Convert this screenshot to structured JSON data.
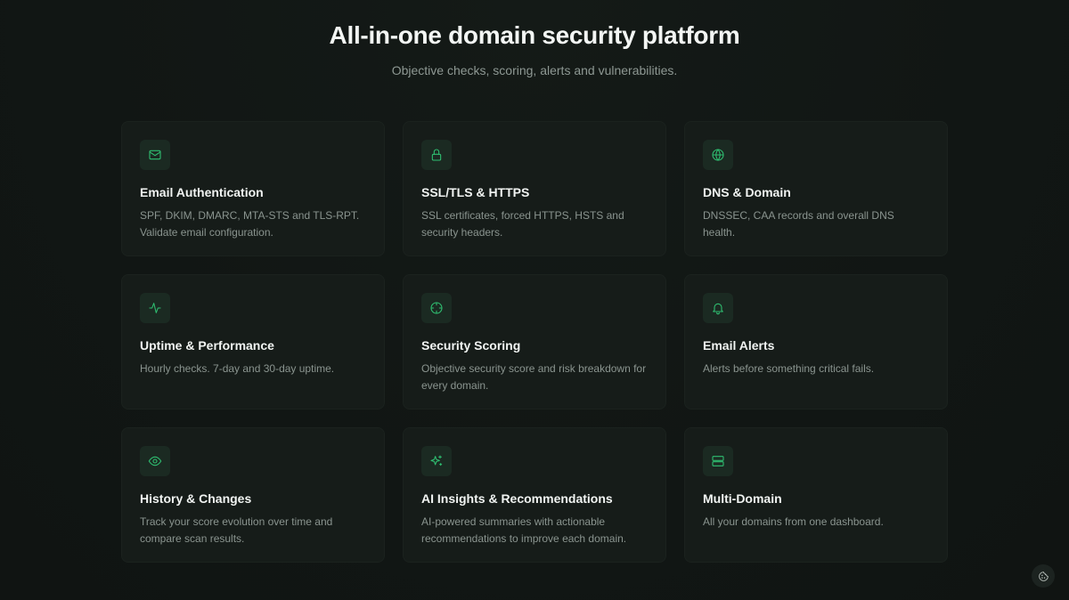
{
  "hero": {
    "title": "All-in-one domain security platform",
    "subtitle": "Objective checks, scoring, alerts and vulnerabilities."
  },
  "accent_color": "#2fbf71",
  "features": [
    {
      "icon": "mail-icon",
      "title": "Email Authentication",
      "description": "SPF, DKIM, DMARC, MTA-STS and TLS-RPT. Validate email configuration."
    },
    {
      "icon": "lock-icon",
      "title": "SSL/TLS & HTTPS",
      "description": "SSL certificates, forced HTTPS, HSTS and security headers."
    },
    {
      "icon": "globe-icon",
      "title": "DNS & Domain",
      "description": "DNSSEC, CAA records and overall DNS health."
    },
    {
      "icon": "activity-icon",
      "title": "Uptime & Performance",
      "description": "Hourly checks. 7-day and 30-day uptime."
    },
    {
      "icon": "crosshair-icon",
      "title": "Security Scoring",
      "description": "Objective security score and risk breakdown for every domain."
    },
    {
      "icon": "bell-icon",
      "title": "Email Alerts",
      "description": "Alerts before something critical fails."
    },
    {
      "icon": "eye-icon",
      "title": "History & Changes",
      "description": "Track your score evolution over time and compare scan results."
    },
    {
      "icon": "sparkles-icon",
      "title": "AI Insights & Recommendations",
      "description": "AI-powered summaries with actionable recommendations to improve each domain."
    },
    {
      "icon": "server-icon",
      "title": "Multi-Domain",
      "description": "All your domains from one dashboard."
    }
  ],
  "corner_button": {
    "icon": "cookie-icon"
  }
}
